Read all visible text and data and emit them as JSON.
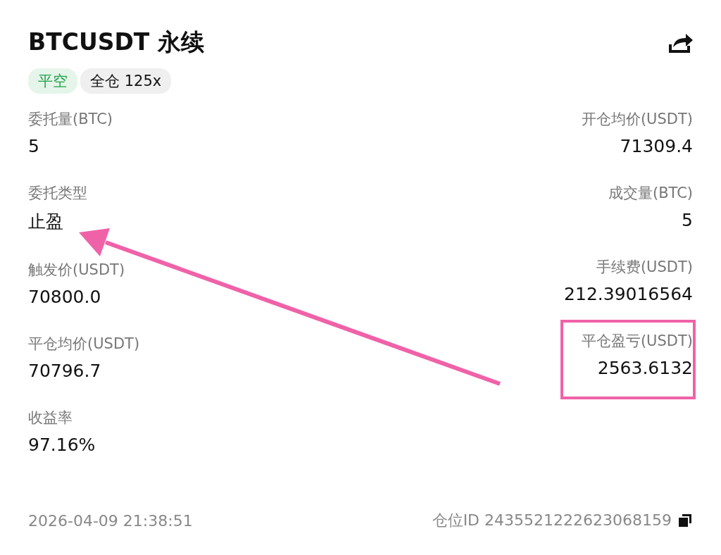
{
  "header": {
    "title": "BTCUSDT 永续"
  },
  "tags": [
    {
      "label": "平空",
      "kind": "side"
    },
    {
      "label": "全仓 125x",
      "kind": "margin"
    }
  ],
  "fields_left": [
    {
      "label": "委托量(BTC)",
      "value": "5",
      "highlighted": false
    },
    {
      "label": "委托类型",
      "value": "止盈",
      "highlighted": false
    },
    {
      "label": "触发价(USDT)",
      "value": "70800.0",
      "highlighted": false
    },
    {
      "label": "平仓均价(USDT)",
      "value": "70796.7",
      "highlighted": false
    },
    {
      "label": "收益率",
      "value": "97.16%",
      "highlighted": false
    }
  ],
  "fields_right": [
    {
      "label": "开仓均价(USDT)",
      "value": "71309.4",
      "highlighted": false
    },
    {
      "label": "成交量(BTC)",
      "value": "5",
      "highlighted": false
    },
    {
      "label": "手续费(USDT)",
      "value": "212.39016564",
      "highlighted": false
    },
    {
      "label": "平仓盈亏(USDT)",
      "value": "2563.6132",
      "highlighted": true
    }
  ],
  "footer": {
    "time": "2026-04-09 21:38:51",
    "position_id": "仓位ID 2435521222623068159"
  }
}
